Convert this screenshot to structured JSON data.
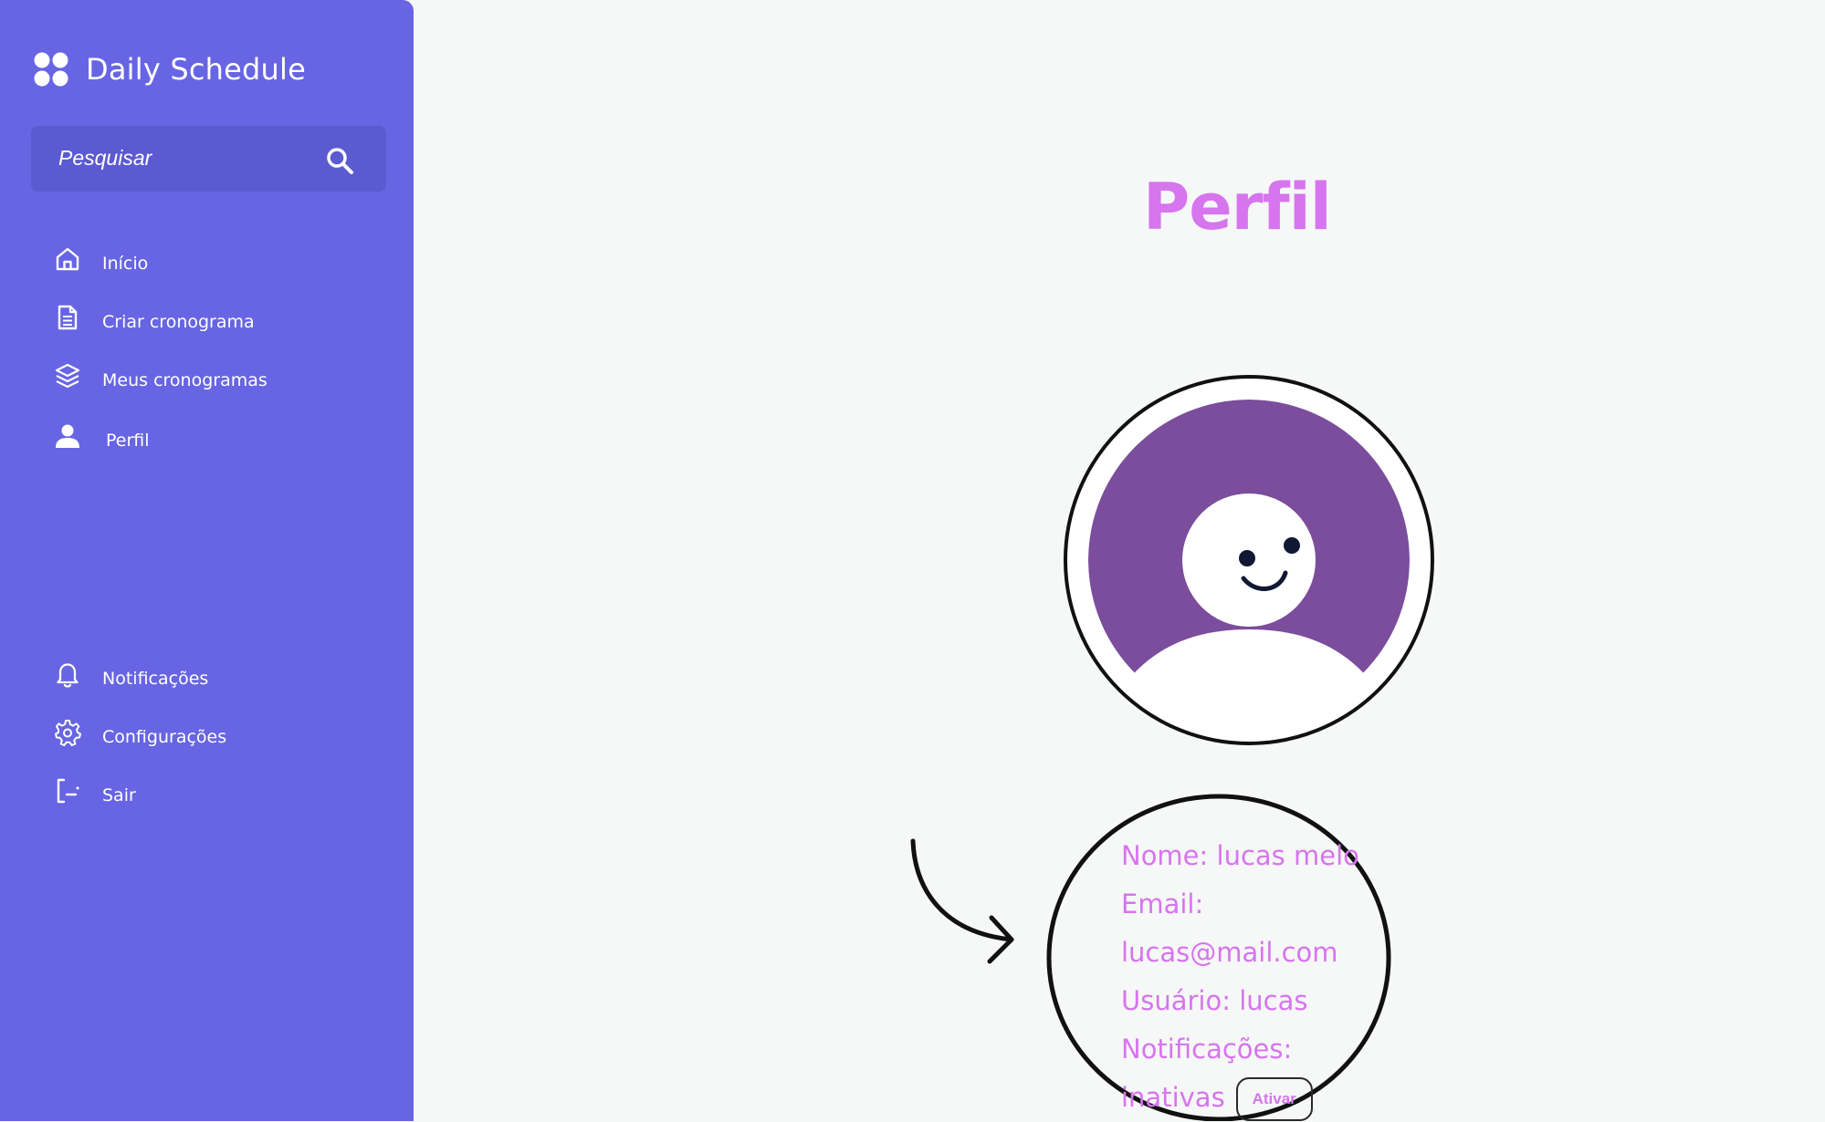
{
  "app": {
    "title": "Daily Schedule",
    "logo_icon": "four-dots-logo-icon"
  },
  "search": {
    "placeholder": "Pesquisar",
    "icon": "search-icon"
  },
  "sidebar": {
    "main_items": [
      {
        "label": "Início",
        "icon": "home-icon"
      },
      {
        "label": "Criar cronograma",
        "icon": "document-icon"
      },
      {
        "label": "Meus cronogramas",
        "icon": "layers-icon"
      },
      {
        "label": "Perfil",
        "icon": "user-icon"
      }
    ],
    "bottom_items": [
      {
        "label": "Notificações",
        "icon": "bell-icon"
      },
      {
        "label": "Configurações",
        "icon": "gear-icon"
      },
      {
        "label": "Sair",
        "icon": "logout-icon"
      }
    ]
  },
  "main": {
    "title": "Perfil",
    "avatar_icon": "smiling-avatar-icon",
    "profile": {
      "name_line": "Nome: lucas melo",
      "email_label": "Email:",
      "email_value": "lucas@mail.com",
      "user_line": "Usuário: lucas",
      "notifications_label": "Notificações:",
      "notifications_status": "inativas",
      "activate_button": "Ativar"
    }
  },
  "colors": {
    "sidebar": "#6765e3",
    "search_bg": "#5b5ad0",
    "accent": "#d675ee",
    "avatar_ring": "#7b4d9c",
    "background": "#f6f7f7"
  }
}
